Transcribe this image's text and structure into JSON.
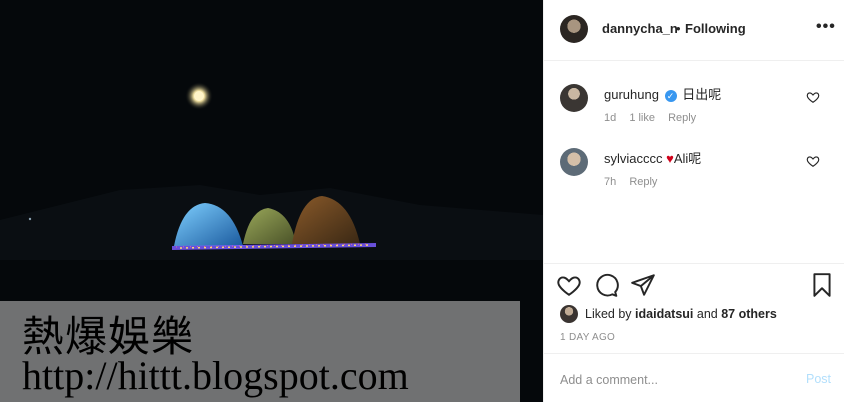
{
  "post": {
    "username": "dannycha_n",
    "separator": "•",
    "follow_status": "Following",
    "more_label": "•••"
  },
  "watermark": {
    "title": "熱爆娛樂",
    "url": "http://hittt.blogspot.com"
  },
  "comments": [
    {
      "user": "guruhung",
      "verified": true,
      "text": "日出呢",
      "time": "1d",
      "likes": "1 like",
      "reply": "Reply"
    },
    {
      "user": "sylviacccc",
      "verified": false,
      "emoji": "♥",
      "text": "Ali呢",
      "time": "7h",
      "reply": "Reply"
    }
  ],
  "likes": {
    "prefix": "Liked by",
    "user": "idaidatsui",
    "suffix": "and",
    "others": "87 others"
  },
  "date": "1 DAY AGO",
  "add_comment": {
    "placeholder": "Add a comment...",
    "post_label": "Post"
  },
  "colors": {
    "verified": "#3897f0",
    "post_disabled": "#b2dffc",
    "heart": "#d0021b"
  }
}
